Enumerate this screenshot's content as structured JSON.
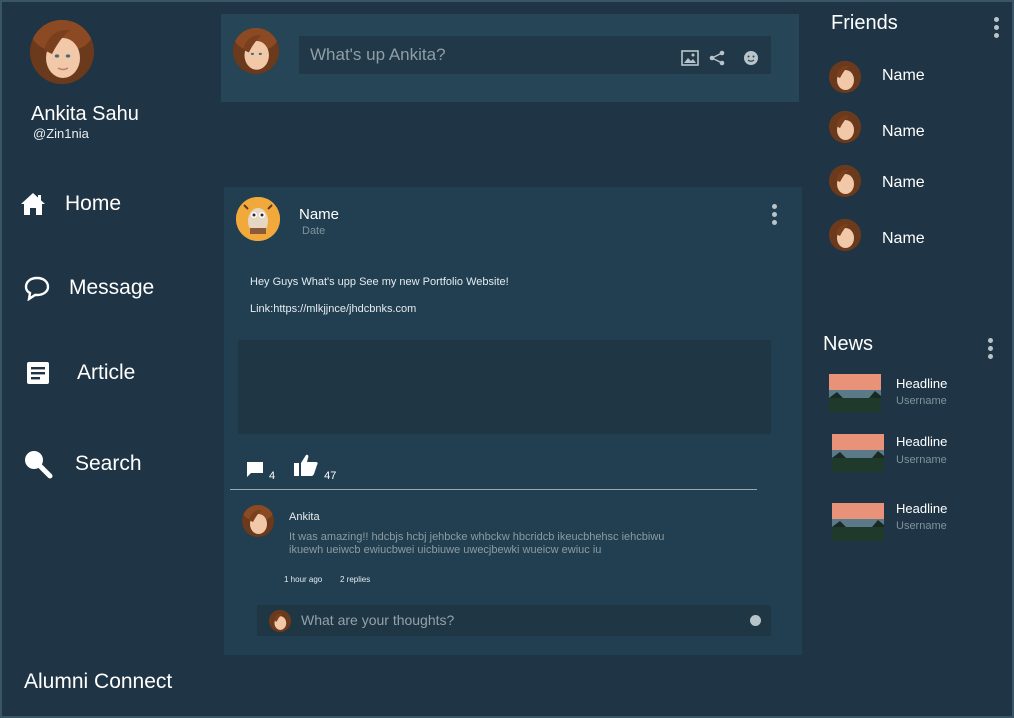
{
  "profile": {
    "name": "Ankita Sahu",
    "handle": "@Zin1nia"
  },
  "nav": {
    "items": [
      {
        "label": "Home",
        "icon": "home-icon"
      },
      {
        "label": "Message",
        "icon": "message-icon"
      },
      {
        "label": "Article",
        "icon": "article-icon"
      },
      {
        "label": "Search",
        "icon": "search-icon"
      }
    ]
  },
  "app": {
    "name": "Alumni Connect"
  },
  "composer": {
    "placeholder": "What's up Ankita?",
    "tools": [
      "image-icon",
      "share-icon",
      "emoji-icon"
    ]
  },
  "post": {
    "author": "Name",
    "date": "Date",
    "text_line1": "Hey Guys What's upp See my new Portfolio Website!",
    "text_line2": "Link:https://mlkjjnce/jhdcbnks.com",
    "comments_count": "4",
    "likes_count": "47",
    "comment": {
      "author": "Ankita",
      "body": "It was amazing!! hdcbjs  hcbj jehbcke whbckw hbcridcb ikeucbhehsc iehcbiwu ikuewh ueiwcb ewiucbwei uicbiuwe uwecjbewki wueicw ewiuc iu",
      "time": "1 hour ago",
      "replies": "2 replies"
    },
    "reply_placeholder": "What are your thoughts?"
  },
  "friends": {
    "title": "Friends",
    "items": [
      {
        "name": "Name"
      },
      {
        "name": "Name"
      },
      {
        "name": "Name"
      },
      {
        "name": "Name"
      }
    ]
  },
  "news": {
    "title": "News",
    "items": [
      {
        "headline": "Headline",
        "username": "Username"
      },
      {
        "headline": "Headline",
        "username": "Username"
      },
      {
        "headline": "Headline",
        "username": "Username"
      }
    ]
  },
  "colors": {
    "background": "#1f3444",
    "card": "#223f51",
    "composer": "#264556",
    "input": "#203847",
    "muted_text": "#7f949e"
  }
}
